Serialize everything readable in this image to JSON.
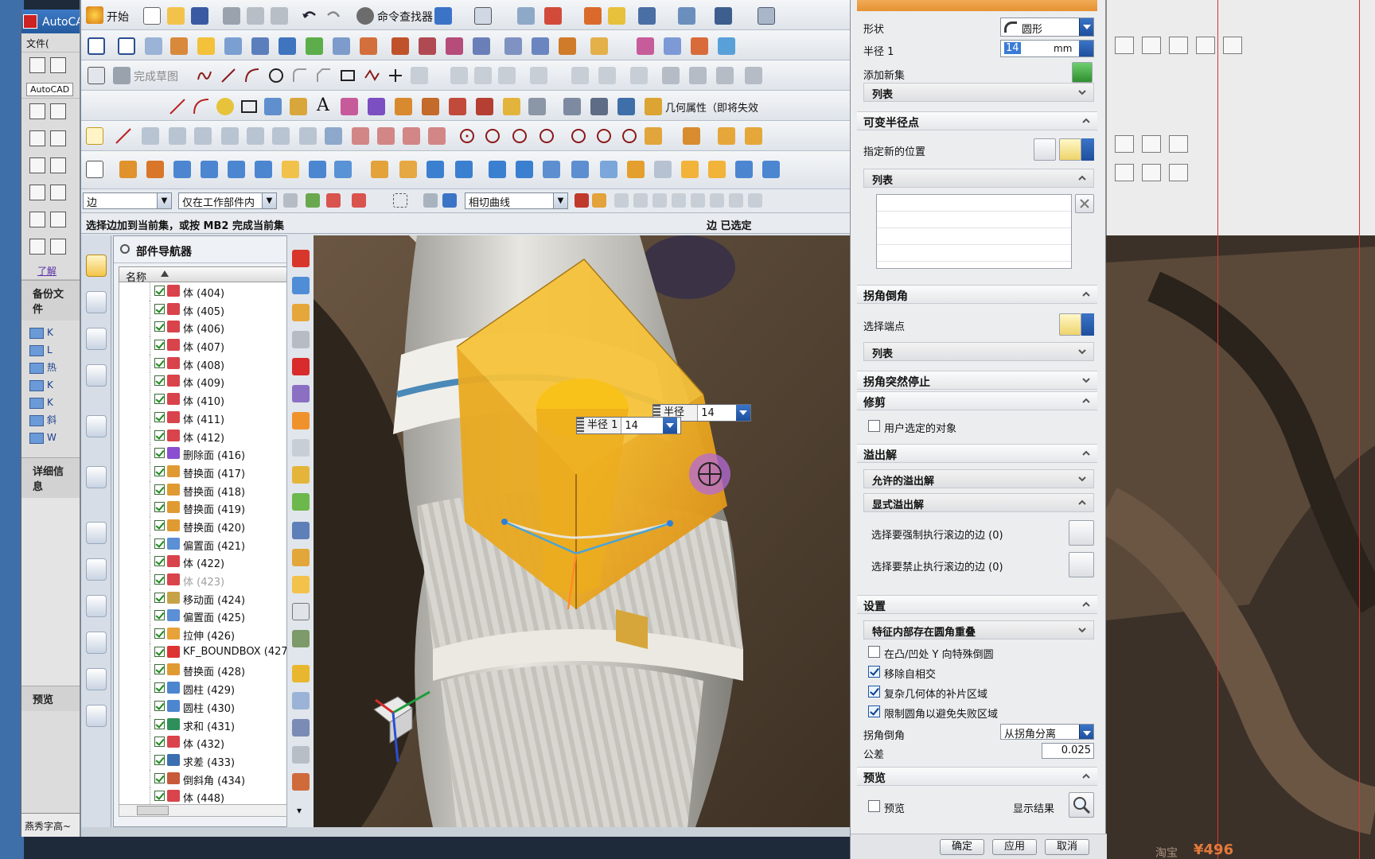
{
  "autocad": {
    "title": "AutoCA",
    "tab": "AutoCAD",
    "file_menu": "文件(",
    "sections": [
      "备份文件",
      "详细信息",
      "预览"
    ],
    "tree_items": [
      "K",
      "L",
      "热",
      "K",
      "K",
      "斜",
      "W"
    ],
    "help_link": "了解",
    "taskbar_text": "燕秀字高~"
  },
  "nx": {
    "menu": {
      "start": "开始",
      "command_finder": "命令查找器"
    },
    "toolbar": {
      "finish_sketch": "完成草图",
      "geometry_props": "几何属性（即将失效"
    },
    "filter": {
      "type_filter": "边",
      "scope_filter": "仅在工作部件内",
      "curve_rule": "相切曲线"
    },
    "status": {
      "prompt": "选择边加到当前集，或按 MB2 完成当前集",
      "selection": "边 已选定"
    },
    "navigator": {
      "title": "部件导航器",
      "column": "名称",
      "rows": [
        {
          "label": "体 (404)",
          "icon": "body-icon",
          "greyed": false
        },
        {
          "label": "体 (405)",
          "icon": "body-icon",
          "greyed": false
        },
        {
          "label": "体 (406)",
          "icon": "body-icon",
          "greyed": false
        },
        {
          "label": "体 (407)",
          "icon": "body-icon",
          "greyed": false
        },
        {
          "label": "体 (408)",
          "icon": "body-icon",
          "greyed": false
        },
        {
          "label": "体 (409)",
          "icon": "body-icon",
          "greyed": false
        },
        {
          "label": "体 (410)",
          "icon": "body-icon",
          "greyed": false
        },
        {
          "label": "体 (411)",
          "icon": "body-icon",
          "greyed": false
        },
        {
          "label": "体 (412)",
          "icon": "body-icon",
          "greyed": false
        },
        {
          "label": "删除面 (416)",
          "icon": "delete-face-icon",
          "greyed": false
        },
        {
          "label": "替换面 (417)",
          "icon": "replace-face-icon",
          "greyed": false
        },
        {
          "label": "替换面 (418)",
          "icon": "replace-face-icon",
          "greyed": false
        },
        {
          "label": "替换面 (419)",
          "icon": "replace-face-icon",
          "greyed": false
        },
        {
          "label": "替换面 (420)",
          "icon": "replace-face-icon",
          "greyed": false
        },
        {
          "label": "偏置面 (421)",
          "icon": "offset-face-icon",
          "greyed": false
        },
        {
          "label": "体 (422)",
          "icon": "body-icon",
          "greyed": false
        },
        {
          "label": "体 (423)",
          "icon": "body-icon",
          "greyed": true
        },
        {
          "label": "移动面 (424)",
          "icon": "move-face-icon",
          "greyed": false
        },
        {
          "label": "偏置面 (425)",
          "icon": "offset-face-icon",
          "greyed": false
        },
        {
          "label": "拉伸 (426)",
          "icon": "extrude-icon",
          "greyed": false
        },
        {
          "label": "KF_BOUNDBOX (427)",
          "icon": "boundbox-icon",
          "greyed": false
        },
        {
          "label": "替换面 (428)",
          "icon": "replace-face-icon",
          "greyed": false
        },
        {
          "label": "圆柱 (429)",
          "icon": "cylinder-icon",
          "greyed": false
        },
        {
          "label": "圆柱 (430)",
          "icon": "cylinder-icon",
          "greyed": false
        },
        {
          "label": "求和 (431)",
          "icon": "unite-icon",
          "greyed": false
        },
        {
          "label": "体 (432)",
          "icon": "body-icon",
          "greyed": false
        },
        {
          "label": "求差 (433)",
          "icon": "subtract-icon",
          "greyed": false
        },
        {
          "label": "倒斜角 (434)",
          "icon": "chamfer-icon",
          "greyed": false
        },
        {
          "label": "体 (448)",
          "icon": "body-icon",
          "greyed": false
        }
      ]
    },
    "viewport": {
      "radius_label_1": "半径 1",
      "radius_value_1": "14",
      "radius_label_2": "半径 1",
      "radius_value_2": "14"
    }
  },
  "dialog": {
    "shape_label": "形状",
    "shape_value": "圆形",
    "radius_label": "半径 1",
    "radius_value": "14",
    "radius_unit": "mm",
    "add_new_set": "添加新集",
    "list": "列表",
    "var_radius": {
      "title": "可变半径点",
      "specify_location": "指定新的位置",
      "list": "列表"
    },
    "corner_setback": {
      "title": "拐角倒角",
      "select_vertex": "选择端点",
      "list": "列表"
    },
    "corner_stop": {
      "title": "拐角突然停止"
    },
    "trim": {
      "title": "修剪",
      "user_selected": "用户选定的对象"
    },
    "overflow": {
      "title": "溢出解",
      "allowed": "允许的溢出解",
      "explicit": "显式溢出解",
      "force_roll": "选择要强制执行滚边的边 (0)",
      "prohibit_roll": "选择要禁止执行滚边的边 (0)"
    },
    "settings": {
      "title": "设置",
      "overlap": "特征内部存在圆角重叠",
      "special_y": "在凸/凹处 Y 向特殊倒圆",
      "remove_self_intersect": "移除自相交",
      "patch_complex": "复杂几何体的补片区域",
      "limit_fillet": "限制圆角以避免失败区域",
      "corner_setback_label": "拐角倒角",
      "corner_setback_value": "从拐角分离",
      "tolerance_label": "公差",
      "tolerance_value": "0.025"
    },
    "preview": {
      "title": "预览",
      "preview": "预览",
      "show_result": "显示结果"
    },
    "buttons": {
      "ok": "确定",
      "apply": "应用",
      "cancel": "取消"
    },
    "checks": {
      "user_selected": false,
      "special_y": false,
      "remove_self_intersect": true,
      "patch_complex": true,
      "limit_fillet": true,
      "preview": false
    }
  },
  "background": {
    "shop": "淘宝",
    "price": "¥496"
  },
  "colors": {
    "accent_blue": "#1e4f9d",
    "dialog_title_orange": "#e49131",
    "selection_orange": "#f3b11c",
    "red_guide": "#d33333"
  }
}
